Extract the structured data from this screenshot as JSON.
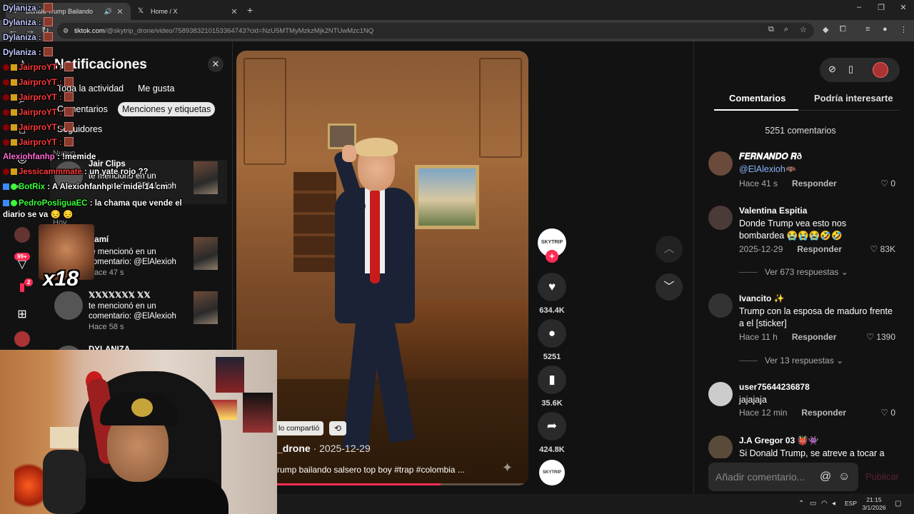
{
  "browser": {
    "tabs": [
      {
        "title": "Donald Trump Bailando",
        "active": true
      },
      {
        "title": "Home / X",
        "active": false
      }
    ],
    "new_tab": "+",
    "url_host": "tiktok.com",
    "url_rest": "/@skytrip_drone/video/7589383210153364743?cid=NzU5MTMyMzkzMjk2NTUwMzc1NQ",
    "window_controls": {
      "minimize": "–",
      "restore": "❐",
      "close": "✕"
    }
  },
  "notifications": {
    "title": "Notificaciones",
    "close_icon": "✕",
    "filters": [
      "Toda la actividad",
      "Me gusta",
      "Comentarios",
      "Menciones y etiquetas",
      "Seguidores"
    ],
    "selected_filter": "Menciones y etiquetas",
    "section_new": "Nuevo",
    "section_today": "Hoy",
    "items": [
      {
        "name": "Jair Clips",
        "text": "te mencionó en un comentario: @ElAlexioh",
        "time": ""
      },
      {
        "name": "Camí",
        "text": "te mencionó en un comentario: @ElAlexioh",
        "time": "Hace 47 s"
      },
      {
        "name": "𝕏𝕏𝕏𝕏𝕏𝕏𝕏 𝕏𝕏",
        "text": "te mencionó en un comentario: @ElAlexioh",
        "time": "Hace 58 s"
      },
      {
        "name": "DYLANIZA",
        "text": "",
        "time": ""
      }
    ]
  },
  "rail": {
    "badge_inbox": "99+",
    "badge_messages": "2"
  },
  "chat": [
    {
      "user": "Dylaniza",
      "color": "#c0c8ff",
      "text": ""
    },
    {
      "user": "Dylaniza",
      "color": "#c0c8ff",
      "text": ""
    },
    {
      "user": "Dylaniza",
      "color": "#c0c8ff",
      "text": ""
    },
    {
      "user": "Dylaniza",
      "color": "#c0c8ff",
      "text": ""
    },
    {
      "user": "JairproYT",
      "color": "#ff3a3a",
      "text": ""
    },
    {
      "user": "JairproYT",
      "color": "#ff3a3a",
      "text": ""
    },
    {
      "user": "JairproYT",
      "color": "#ff3a3a",
      "text": ""
    },
    {
      "user": "JairproYT",
      "color": "#ff3a3a",
      "text": ""
    },
    {
      "user": "JairproYT",
      "color": "#ff3a3a",
      "text": ""
    },
    {
      "user": "JairproYT",
      "color": "#ff3a3a",
      "text": ""
    },
    {
      "user": "Alexiohfanhp",
      "color": "#ff6ad5",
      "text": "!memide"
    },
    {
      "user": "Jessicammmate",
      "color": "#ff3a3a",
      "text": "un yate rojo ??"
    },
    {
      "user": "BotRix",
      "color": "#3aff3a",
      "text": "A Alexiohfanhp le mide 14 cm"
    },
    {
      "user": "PedroPosliguaEC",
      "color": "#3aff3a",
      "text": "la chama que vende el diario se va 😔 😔"
    }
  ],
  "emote_multiplier": "x18",
  "video": {
    "shared_label": "lo compartió",
    "author": "_drone",
    "date": "· 2025-12-29",
    "caption": "rump bailando salsero top boy #trap #colombia ...",
    "progress": 0.7,
    "profile_label": "SKYTRIP",
    "likes": "634.4K",
    "comments": "5251",
    "saves": "35.6K",
    "shares": "424.8K"
  },
  "comments": {
    "tab_comments": "Comentarios",
    "tab_suggested": "Podría interesarte",
    "count_label": "5251 comentarios",
    "list": [
      {
        "user": "𝑭𝑬𝑹𝑵𝑨𝑵𝑫𝑶 𝑹ð",
        "message": "@ElAlexioh🦇",
        "mention": true,
        "time": "Hace 41 s",
        "likes": "0",
        "reply": "Responder"
      },
      {
        "user": "Valentina Espitia",
        "message": "Donde Trump vea esto nos bombardea 😭😭😭🤣🤣",
        "mention": false,
        "time": "2025-12-29",
        "likes": "83K",
        "reply": "Responder"
      },
      {
        "user": "Ivancito ✨",
        "message": "Trump con la esposa de maduro frente a el [sticker]",
        "mention": false,
        "time": "Hace 11 h",
        "likes": "1390",
        "reply": "Responder"
      },
      {
        "user": "user75644236878",
        "message": "jajajaja",
        "mention": false,
        "time": "Hace 12 min",
        "likes": "0",
        "reply": "Responder"
      },
      {
        "user": "J.A Gregor 03 👹👾",
        "message": "Si Donald Trump, se atreve a tocar a Ma",
        "mention": false,
        "time": "",
        "likes": "",
        "reply": ""
      }
    ],
    "replies_1": "Ver 673 respuestas",
    "replies_2": "Ver 13 respuestas",
    "input_placeholder": "Añadir comentario...",
    "publish_label": "Publicar"
  },
  "taskbar": {
    "lang": "ESP",
    "time": "21:15",
    "date": "3/1/2026"
  },
  "colors": {
    "accent": "#fe2c55",
    "background": "#121212"
  }
}
